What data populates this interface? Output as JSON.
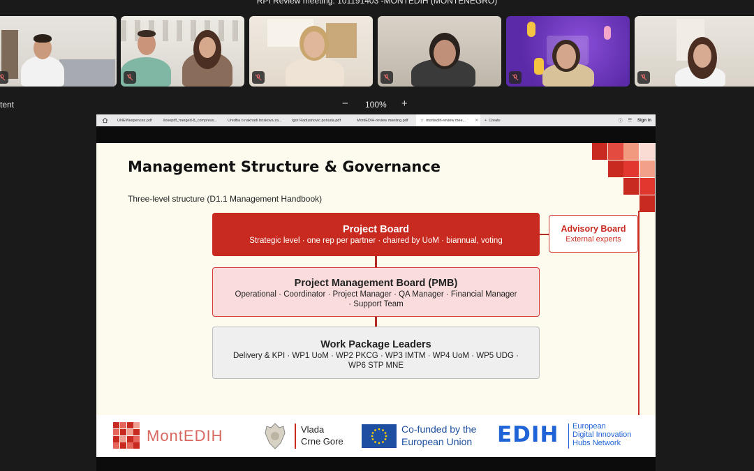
{
  "meeting": {
    "title": "RPI Review meeting: 101191403 -MONTEDIH (MONTENEGRO)"
  },
  "view": {
    "content_label": "tent",
    "zoom_minus": "−",
    "zoom_level": "100%",
    "zoom_plus": "+"
  },
  "browser": {
    "tabs": [
      {
        "label": "UNEWexpences.pdf"
      },
      {
        "label": "ilovepdf_merged-8_compress..."
      },
      {
        "label": "Uredba o naknadi troskova za..."
      },
      {
        "label": "Igor Radusinovic ponuda.pdf"
      },
      {
        "label": "MontEDIH-review meeting.pdf"
      },
      {
        "label": "montedih-review mee...",
        "close": "✕"
      },
      {
        "label": "Create"
      }
    ],
    "signin": "Sign in"
  },
  "slide": {
    "title": "Management Structure & Governance",
    "subtitle": "Three-level structure (D1.1 Management Handbook)",
    "project_board": {
      "title": "Project Board",
      "desc": "Strategic level · one rep per partner · chaired by UoM · biannual, voting"
    },
    "advisory_board": {
      "title": "Advisory Board",
      "desc": "External experts"
    },
    "pmb": {
      "title": "Project Management Board (PMB)",
      "desc1": "Operational · Coordinator · Project Manager · QA Manager · Financial Manager",
      "desc2": "· Support Team"
    },
    "wp": {
      "title": "Work Package Leaders",
      "desc1": "Delivery & KPI · WP1 UoM · WP2 PKCG · WP3 IMTM · WP4 UoM · WP5 UDG ·",
      "desc2": "WP6 STP MNE"
    }
  },
  "logos": {
    "montedih": "MontEDIH",
    "vlada1": "Vlada",
    "vlada2": "Crne Gore",
    "eu1": "Co-funded by the",
    "eu2": "European Union",
    "edih_mark": "EDIH",
    "edih1": "European",
    "edih2": "Digital Innovation",
    "edih3": "Hubs Network"
  },
  "colors": {
    "brand_red": "#c92a1f",
    "edih_blue": "#1f63d6",
    "eu_blue": "#1d4fa0"
  },
  "icons": [
    "home-icon",
    "star-icon",
    "plus-icon",
    "help-icon",
    "extensions-icon",
    "microphone-muted-icon"
  ]
}
